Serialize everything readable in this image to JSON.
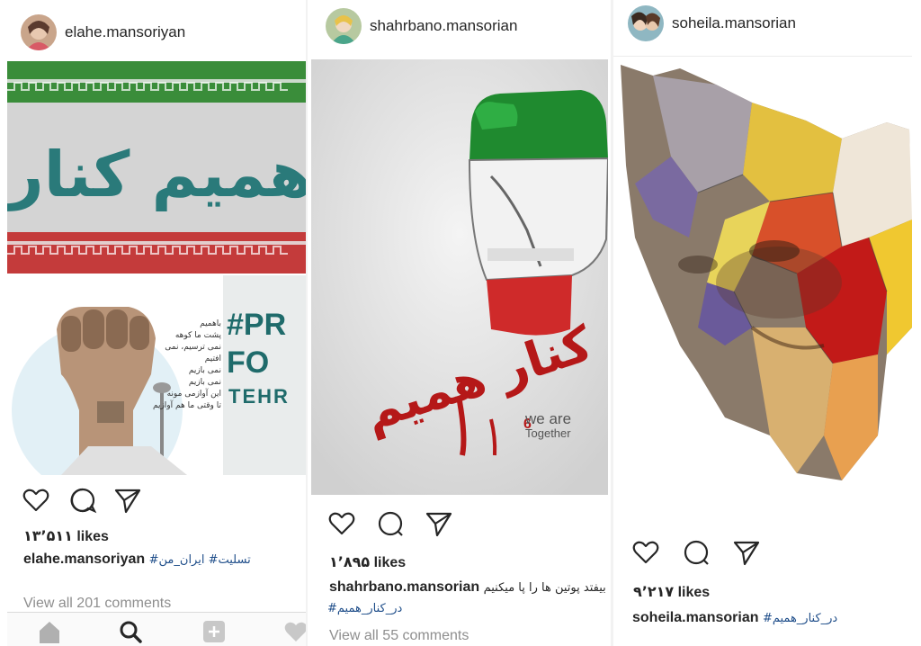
{
  "posts": [
    {
      "username": "elahe.mansoriyan",
      "likes": "۱۳٬۵۱۱ likes",
      "caption_user": "elahe.mansoriyan",
      "caption_tags": "#تسلیت# ایران_من",
      "comments": "View all 201 comments",
      "image_texts": {
        "calligraphy": "همیم کنار",
        "poem": [
          "باهمیم",
          "پشت ما کوهه",
          "نمی ترسیم، نمی افتیم",
          "نمی بازیم",
          "نمی بازیم",
          "این آوازمی مونه",
          "تا وقتی ما هم آوازیم"
        ],
        "banner": [
          "#PR",
          "FO",
          "TEHR"
        ]
      }
    },
    {
      "username": "shahrbano.mansorian",
      "likes": "۱٬۸۹۵ likes",
      "caption_user": "shahrbano.mansorian",
      "caption_text": "بیفتد پوتین ها را پا میکنیم",
      "caption_tags": "#در_کنار_همیم",
      "comments": "View all 55 comments",
      "image_texts": {
        "calligraphy": "در کنار همیم",
        "tagline_1": "we are",
        "tagline_2": "Together"
      }
    },
    {
      "username": "soheila.mansorian",
      "likes": "۹٬۲۱۷ likes",
      "caption_user": "soheila.mansorian",
      "caption_tags": "#در_کنار_همیم"
    }
  ],
  "colors": {
    "green": "#239f40",
    "red": "#da0000",
    "link": "#1f4e8a"
  },
  "icons": [
    "heart-icon",
    "comment-icon",
    "share-icon",
    "home-icon",
    "search-icon",
    "add-icon"
  ]
}
